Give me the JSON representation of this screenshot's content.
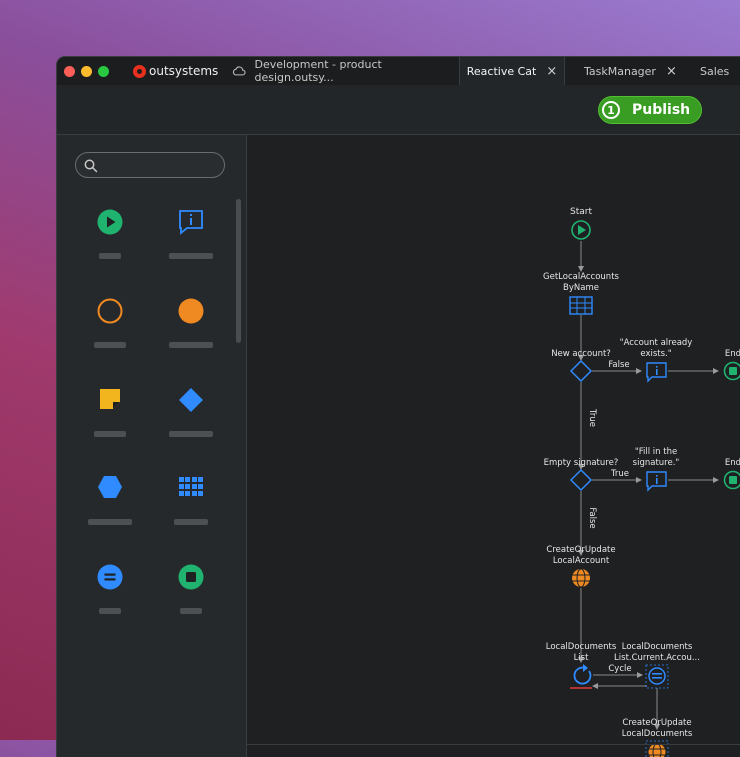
{
  "app": {
    "brand": "outsystems"
  },
  "tabs": [
    {
      "label": "Development - product design.outsy...",
      "active": false
    },
    {
      "label": "Reactive Cat",
      "active": true
    },
    {
      "label": "TaskManager",
      "active": false
    },
    {
      "label": "Sales",
      "active": false
    }
  ],
  "toolbar": {
    "publish_count": "1",
    "publish_label": "Publish"
  },
  "colors": {
    "accent_green": "#3a9d23",
    "node_blue": "#2f8bff",
    "node_green": "#1fb36f",
    "node_orange": "#ef8a22",
    "node_yellow": "#f2b51d"
  },
  "toolbox": {
    "search_placeholder": "",
    "tools": [
      {
        "icon": "start-icon"
      },
      {
        "icon": "message-icon"
      },
      {
        "icon": "empty-circle-icon"
      },
      {
        "icon": "filled-circle-icon"
      },
      {
        "icon": "sticky-note-icon"
      },
      {
        "icon": "diamond-icon"
      },
      {
        "icon": "hexagon-icon"
      },
      {
        "icon": "aggregate-icon"
      },
      {
        "icon": "assign-icon"
      },
      {
        "icon": "end-icon"
      }
    ]
  },
  "flow": {
    "start": "Start",
    "get_local": [
      "GetLocalAccounts",
      "ByName"
    ],
    "new_account": "New account?",
    "false1": "False",
    "msg1": [
      "\"Account already",
      "exists.\""
    ],
    "end1": "End",
    "true1": "True",
    "empty_sig": "Empty signature?",
    "true2": "True",
    "msg2": [
      "\"Fill in the",
      "signature.\""
    ],
    "end2": "End",
    "false2": "False",
    "create_account": [
      "CreateOrUpdate",
      "LocalAccount"
    ],
    "docs_list": [
      "LocalDocuments",
      "List"
    ],
    "cycle": "Cycle",
    "assign": [
      "LocalDocuments",
      "List.Current.Accou..."
    ],
    "create_docs": [
      "CreateOrUpdate",
      "LocalDocuments"
    ]
  }
}
